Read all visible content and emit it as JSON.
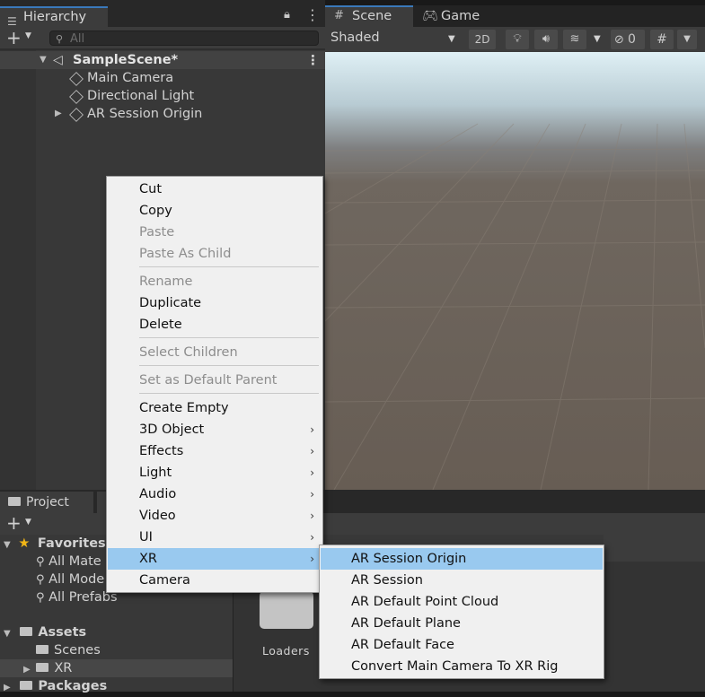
{
  "hierarchy": {
    "tab_label": "Hierarchy",
    "search_placeholder": "All",
    "scene_name": "SampleScene*",
    "objects": [
      "Main Camera",
      "Directional Light",
      "AR Session Origin"
    ]
  },
  "scene_view": {
    "tabs": [
      "Scene",
      "Game"
    ],
    "shading_mode": "Shaded",
    "mode_2d": "2D",
    "hidden_count": "0"
  },
  "project": {
    "tab_label": "Project",
    "favorites_label": "Favorites",
    "favorites": [
      "All Mate",
      "All Mode",
      "All Prefabs"
    ],
    "assets_label": "Assets",
    "asset_folders": [
      "Scenes",
      "XR"
    ],
    "packages_label": "Packages",
    "grid_item_label": "Loaders"
  },
  "context_menu": {
    "items": [
      {
        "label": "Cut"
      },
      {
        "label": "Copy"
      },
      {
        "label": "Paste"
      },
      {
        "label": "Paste As Child"
      },
      {
        "label": "Rename"
      },
      {
        "label": "Duplicate"
      },
      {
        "label": "Delete"
      },
      {
        "label": "Select Children"
      },
      {
        "label": "Set as Default Parent"
      },
      {
        "label": "Create Empty"
      },
      {
        "label": "3D Object"
      },
      {
        "label": "Effects"
      },
      {
        "label": "Light"
      },
      {
        "label": "Audio"
      },
      {
        "label": "Video"
      },
      {
        "label": "UI"
      },
      {
        "label": "XR"
      },
      {
        "label": "Camera"
      }
    ]
  },
  "xr_submenu": {
    "items": [
      "AR Session Origin",
      "AR Session",
      "AR Default Point Cloud",
      "AR Default Plane",
      "AR Default Face",
      "Convert Main Camera To XR Rig"
    ]
  },
  "colors": {
    "highlight": "#99c9ef",
    "tab_accent": "#3a79bb",
    "panel_bg": "#383838"
  }
}
